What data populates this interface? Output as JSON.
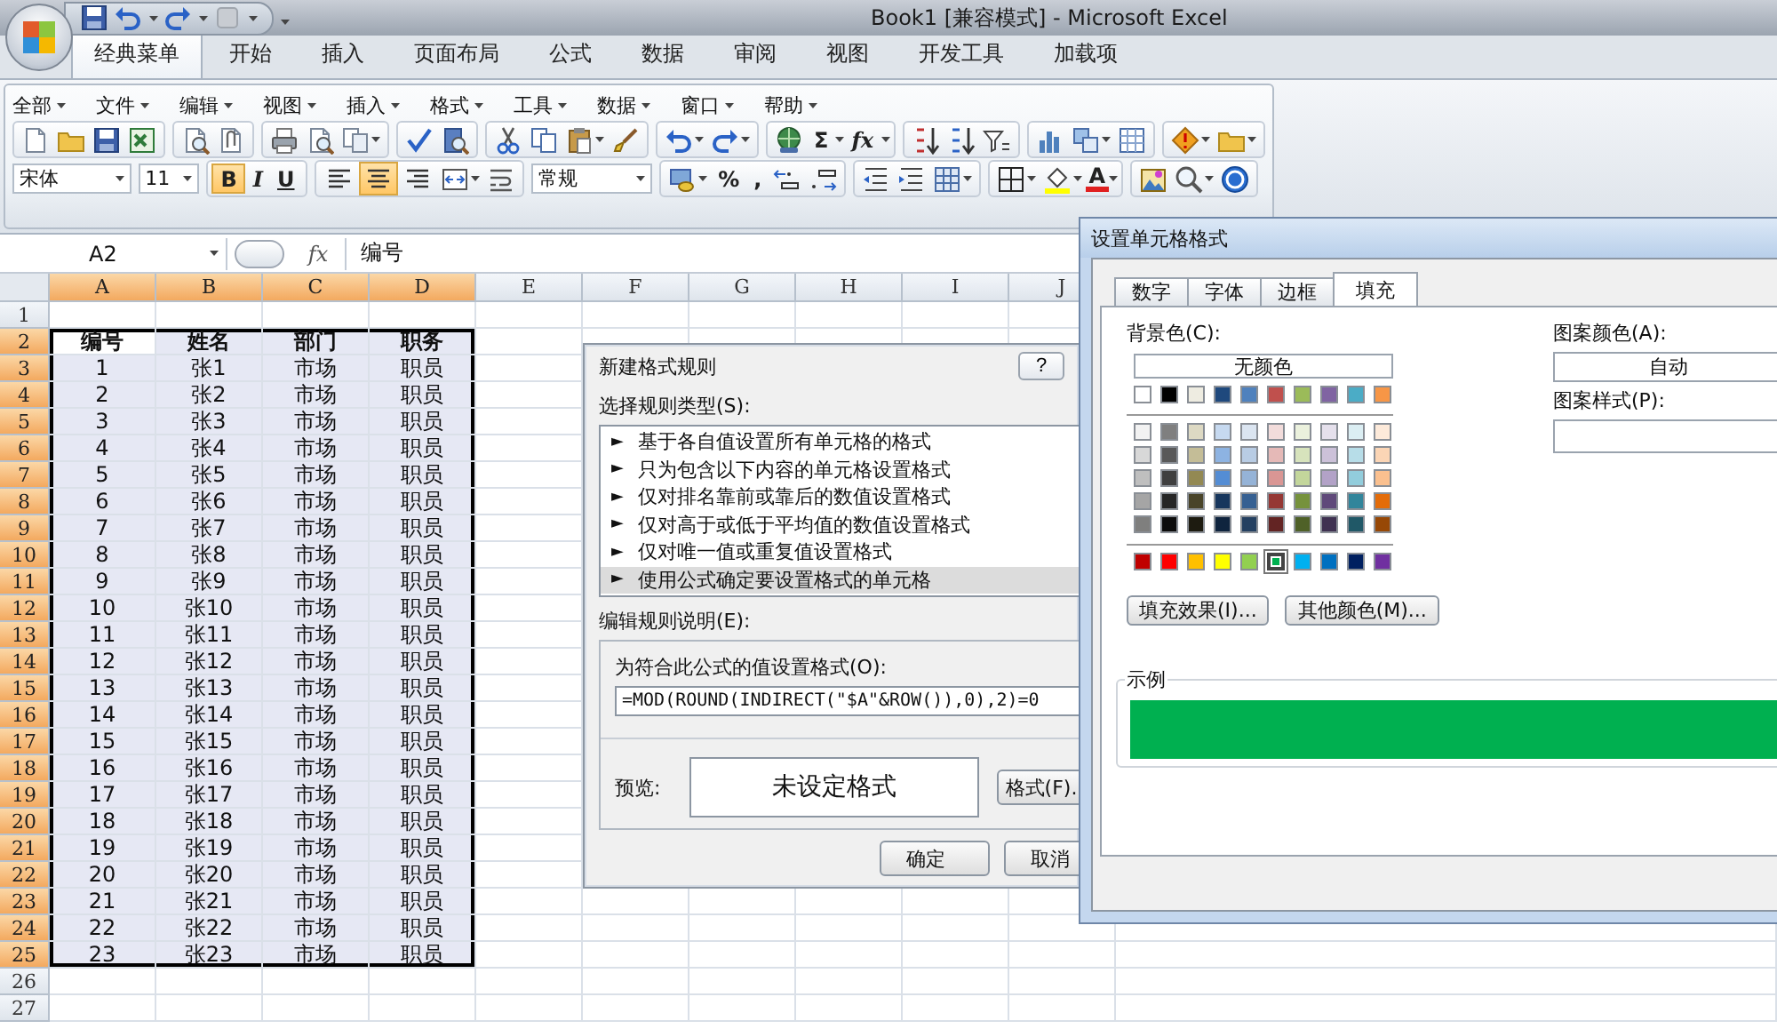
{
  "window": {
    "title": "Book1  [兼容模式] - Microsoft Excel"
  },
  "ribbon_tabs": [
    {
      "label": "经典菜单",
      "selected": true
    },
    {
      "label": "开始",
      "selected": false
    },
    {
      "label": "插入",
      "selected": false
    },
    {
      "label": "页面布局",
      "selected": false
    },
    {
      "label": "公式",
      "selected": false
    },
    {
      "label": "数据",
      "selected": false
    },
    {
      "label": "审阅",
      "selected": false
    },
    {
      "label": "视图",
      "selected": false
    },
    {
      "label": "开发工具",
      "selected": false
    },
    {
      "label": "加载项",
      "selected": false
    }
  ],
  "menu": [
    "全部",
    "文件",
    "编辑",
    "视图",
    "插入",
    "格式",
    "工具",
    "数据",
    "窗口",
    "帮助"
  ],
  "toolbar": {
    "sum": "Σ",
    "function": "fx",
    "font": "宋体",
    "size": "11",
    "bold": {
      "label": "B",
      "selected": true
    },
    "italic": {
      "label": "I",
      "selected": false
    },
    "underline": {
      "label": "U",
      "selected": false
    },
    "align": [
      {
        "kind": "left",
        "selected": false
      },
      {
        "kind": "center",
        "selected": true
      },
      {
        "kind": "right",
        "selected": false
      }
    ],
    "number_format": "常规",
    "percent": "%",
    "comma": ",",
    "font_color": "A"
  },
  "formula_bar": {
    "name_box": "A2",
    "fx": "fx",
    "value": "编号"
  },
  "sheet": {
    "columns": [
      {
        "label": "A",
        "selected": true
      },
      {
        "label": "B",
        "selected": true
      },
      {
        "label": "C",
        "selected": true
      },
      {
        "label": "D",
        "selected": true
      },
      {
        "label": "E",
        "selected": false
      },
      {
        "label": "F",
        "selected": false
      },
      {
        "label": "G",
        "selected": false
      },
      {
        "label": "H",
        "selected": false
      },
      {
        "label": "I",
        "selected": false
      },
      {
        "label": "J",
        "selected": false
      }
    ],
    "rows": [
      {
        "label": "1",
        "selected": false,
        "kind": "data"
      },
      {
        "label": "2",
        "selected": true,
        "kind": "header",
        "cells": [
          "编号",
          "姓名",
          "部门",
          "职务"
        ]
      },
      {
        "label": "3",
        "selected": true,
        "kind": "data",
        "cells": [
          "1",
          "张1",
          "市场",
          "职员"
        ]
      },
      {
        "label": "4",
        "selected": true,
        "kind": "data",
        "cells": [
          "2",
          "张2",
          "市场",
          "职员"
        ]
      },
      {
        "label": "5",
        "selected": true,
        "kind": "data",
        "cells": [
          "3",
          "张3",
          "市场",
          "职员"
        ]
      },
      {
        "label": "6",
        "selected": true,
        "kind": "data",
        "cells": [
          "4",
          "张4",
          "市场",
          "职员"
        ]
      },
      {
        "label": "7",
        "selected": true,
        "kind": "data",
        "cells": [
          "5",
          "张5",
          "市场",
          "职员"
        ]
      },
      {
        "label": "8",
        "selected": true,
        "kind": "data",
        "cells": [
          "6",
          "张6",
          "市场",
          "职员"
        ]
      },
      {
        "label": "9",
        "selected": true,
        "kind": "data",
        "cells": [
          "7",
          "张7",
          "市场",
          "职员"
        ]
      },
      {
        "label": "10",
        "selected": true,
        "kind": "data",
        "cells": [
          "8",
          "张8",
          "市场",
          "职员"
        ]
      },
      {
        "label": "11",
        "selected": true,
        "kind": "data",
        "cells": [
          "9",
          "张9",
          "市场",
          "职员"
        ]
      },
      {
        "label": "12",
        "selected": true,
        "kind": "data",
        "cells": [
          "10",
          "张10",
          "市场",
          "职员"
        ]
      },
      {
        "label": "13",
        "selected": true,
        "kind": "data",
        "cells": [
          "11",
          "张11",
          "市场",
          "职员"
        ]
      },
      {
        "label": "14",
        "selected": true,
        "kind": "data",
        "cells": [
          "12",
          "张12",
          "市场",
          "职员"
        ]
      },
      {
        "label": "15",
        "selected": true,
        "kind": "data",
        "cells": [
          "13",
          "张13",
          "市场",
          "职员"
        ]
      },
      {
        "label": "16",
        "selected": true,
        "kind": "data",
        "cells": [
          "14",
          "张14",
          "市场",
          "职员"
        ]
      },
      {
        "label": "17",
        "selected": true,
        "kind": "data",
        "cells": [
          "15",
          "张15",
          "市场",
          "职员"
        ]
      },
      {
        "label": "18",
        "selected": true,
        "kind": "data",
        "cells": [
          "16",
          "张16",
          "市场",
          "职员"
        ]
      },
      {
        "label": "19",
        "selected": true,
        "kind": "data",
        "cells": [
          "17",
          "张17",
          "市场",
          "职员"
        ]
      },
      {
        "label": "20",
        "selected": true,
        "kind": "data",
        "cells": [
          "18",
          "张18",
          "市场",
          "职员"
        ]
      },
      {
        "label": "21",
        "selected": true,
        "kind": "data",
        "cells": [
          "19",
          "张19",
          "市场",
          "职员"
        ]
      },
      {
        "label": "22",
        "selected": true,
        "kind": "data",
        "cells": [
          "20",
          "张20",
          "市场",
          "职员"
        ]
      },
      {
        "label": "23",
        "selected": true,
        "kind": "data",
        "cells": [
          "21",
          "张21",
          "市场",
          "职员"
        ]
      },
      {
        "label": "24",
        "selected": true,
        "kind": "data",
        "cells": [
          "22",
          "张22",
          "市场",
          "职员"
        ]
      },
      {
        "label": "25",
        "selected": true,
        "kind": "data",
        "cells": [
          "23",
          "张23",
          "市场",
          "职员"
        ]
      },
      {
        "label": "26",
        "selected": false,
        "kind": "data"
      },
      {
        "label": "27",
        "selected": false,
        "kind": "data"
      }
    ]
  },
  "rule_dialog": {
    "title": "新建格式规则",
    "help": "?",
    "type_label": "选择规则类型(S):",
    "types": [
      {
        "marker": "►",
        "label": "基于各自值设置所有单元格的格式",
        "selected": false
      },
      {
        "marker": "►",
        "label": "只为包含以下内容的单元格设置格式",
        "selected": false
      },
      {
        "marker": "►",
        "label": "仅对排名靠前或靠后的数值设置格式",
        "selected": false
      },
      {
        "marker": "►",
        "label": "仅对高于或低于平均值的数值设置格式",
        "selected": false
      },
      {
        "marker": "►",
        "label": "仅对唯一值或重复值设置格式",
        "selected": false
      },
      {
        "marker": "►",
        "label": "使用公式确定要设置格式的单元格",
        "selected": true
      }
    ],
    "desc_label": "编辑规则说明(E):",
    "formula_label": "为符合此公式的值设置格式(O):",
    "formula": "=MOD(ROUND(INDIRECT(\"$A\"&ROW()),0),2)=0",
    "preview_label": "预览:",
    "preview": "未设定格式",
    "format_button": "格式(F).",
    "buttons": [
      "确定",
      "取消"
    ]
  },
  "format_dialog": {
    "title": "设置单元格格式",
    "tabs": [
      {
        "label": "数字",
        "selected": false
      },
      {
        "label": "字体",
        "selected": false
      },
      {
        "label": "边框",
        "selected": false
      },
      {
        "label": "填充",
        "selected": true
      }
    ],
    "bg_label": "背景色(C):",
    "no_color": "无颜色",
    "theme_row": [
      {
        "color": "#ffffff",
        "selected": false
      },
      {
        "color": "#000000",
        "selected": false
      },
      {
        "color": "#eeece1",
        "selected": false
      },
      {
        "color": "#1f497d",
        "selected": false
      },
      {
        "color": "#4f81bd",
        "selected": false
      },
      {
        "color": "#c0504d",
        "selected": false
      },
      {
        "color": "#9bbb59",
        "selected": false
      },
      {
        "color": "#8064a2",
        "selected": false
      },
      {
        "color": "#4bacc6",
        "selected": false
      },
      {
        "color": "#f79646",
        "selected": false
      }
    ],
    "tint_rows": [
      [
        {
          "color": "#f2f2f2",
          "selected": false
        },
        {
          "color": "#7f7f7f",
          "selected": false
        },
        {
          "color": "#ddd9c3",
          "selected": false
        },
        {
          "color": "#c6d9f0",
          "selected": false
        },
        {
          "color": "#dbe5f1",
          "selected": false
        },
        {
          "color": "#f2dcdb",
          "selected": false
        },
        {
          "color": "#ebf1dd",
          "selected": false
        },
        {
          "color": "#e5e0ec",
          "selected": false
        },
        {
          "color": "#dbeef3",
          "selected": false
        },
        {
          "color": "#fdeada",
          "selected": false
        }
      ],
      [
        {
          "color": "#d8d8d8",
          "selected": false
        },
        {
          "color": "#595959",
          "selected": false
        },
        {
          "color": "#c4bd97",
          "selected": false
        },
        {
          "color": "#8db3e2",
          "selected": false
        },
        {
          "color": "#b8cce4",
          "selected": false
        },
        {
          "color": "#e5b9b7",
          "selected": false
        },
        {
          "color": "#d7e3bc",
          "selected": false
        },
        {
          "color": "#ccc1d9",
          "selected": false
        },
        {
          "color": "#b7dde8",
          "selected": false
        },
        {
          "color": "#fbd5b5",
          "selected": false
        }
      ],
      [
        {
          "color": "#bfbfbf",
          "selected": false
        },
        {
          "color": "#3f3f3f",
          "selected": false
        },
        {
          "color": "#938953",
          "selected": false
        },
        {
          "color": "#548dd4",
          "selected": false
        },
        {
          "color": "#95b3d7",
          "selected": false
        },
        {
          "color": "#d99694",
          "selected": false
        },
        {
          "color": "#c3d69b",
          "selected": false
        },
        {
          "color": "#b2a2c7",
          "selected": false
        },
        {
          "color": "#92cddc",
          "selected": false
        },
        {
          "color": "#fac08f",
          "selected": false
        }
      ],
      [
        {
          "color": "#a5a5a5",
          "selected": false
        },
        {
          "color": "#262626",
          "selected": false
        },
        {
          "color": "#494429",
          "selected": false
        },
        {
          "color": "#17365d",
          "selected": false
        },
        {
          "color": "#366092",
          "selected": false
        },
        {
          "color": "#953734",
          "selected": false
        },
        {
          "color": "#76923c",
          "selected": false
        },
        {
          "color": "#5f497a",
          "selected": false
        },
        {
          "color": "#31859b",
          "selected": false
        },
        {
          "color": "#e36c09",
          "selected": false
        }
      ],
      [
        {
          "color": "#7f7f7e",
          "selected": false
        },
        {
          "color": "#0c0c0c",
          "selected": false
        },
        {
          "color": "#1d1b10",
          "selected": false
        },
        {
          "color": "#0f243e",
          "selected": false
        },
        {
          "color": "#244061",
          "selected": false
        },
        {
          "color": "#632423",
          "selected": false
        },
        {
          "color": "#4f6128",
          "selected": false
        },
        {
          "color": "#3f3151",
          "selected": false
        },
        {
          "color": "#205867",
          "selected": false
        },
        {
          "color": "#974806",
          "selected": false
        }
      ]
    ],
    "standard_row": [
      {
        "color": "#c00000",
        "selected": false
      },
      {
        "color": "#ff0000",
        "selected": false
      },
      {
        "color": "#ffc000",
        "selected": false
      },
      {
        "color": "#ffff00",
        "selected": false
      },
      {
        "color": "#92d050",
        "selected": false
      },
      {
        "color": "#00b050",
        "selected": true
      },
      {
        "color": "#00b0f0",
        "selected": false
      },
      {
        "color": "#0070c0",
        "selected": false
      },
      {
        "color": "#002060",
        "selected": false
      },
      {
        "color": "#7030a0",
        "selected": false
      }
    ],
    "buttons": [
      "填充效果(I)...",
      "其他颜色(M)..."
    ],
    "pattern_color_label": "图案颜色(A):",
    "pattern_color": "自动",
    "pattern_style_label": "图案样式(P):",
    "sample_label": "示例"
  }
}
